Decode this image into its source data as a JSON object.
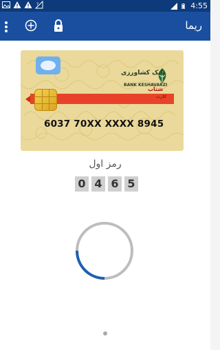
{
  "status_bar": {
    "time": "4:55",
    "left_icons": [
      "image-icon",
      "warning-icon",
      "warning-icon",
      "signal-icon"
    ],
    "right_icons": [
      "signal-4g-icon",
      "battery-icon"
    ]
  },
  "app_bar": {
    "title": "ریما",
    "icons": [
      "overflow-menu-icon",
      "add-circle-icon",
      "lock-icon"
    ],
    "background": "#1a4fa0"
  },
  "card": {
    "bank_name_fa": "بانک کشاورزی",
    "bank_name_en": "BANK KESHAVARZI",
    "brand_fa": "شتاب",
    "brand_fa_sub": "کارت",
    "number": "6037  70XX  XXXX  8945"
  },
  "pin": {
    "label": "رمز اول",
    "digits": [
      "0",
      "4",
      "6",
      "5"
    ]
  },
  "loading": {
    "progress_fraction": 0.25,
    "accent": "#1e5fb5"
  }
}
